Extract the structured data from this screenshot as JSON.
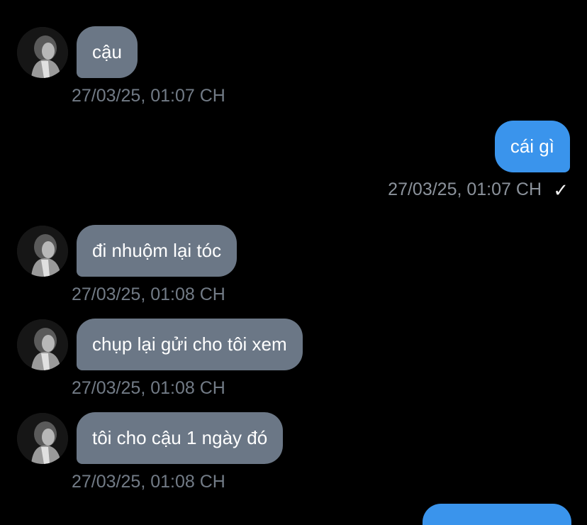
{
  "colors": {
    "background": "#000000",
    "incoming_bubble": "#6b7786",
    "outgoing_bubble": "#3a94ec",
    "timestamp": "#727b86",
    "text": "#ffffff"
  },
  "icons": {
    "avatar": "contact-avatar-photo",
    "read_receipt": "checkmark-icon"
  },
  "messages": [
    {
      "direction": "incoming",
      "text": "cậu",
      "time": "27/03/25, 01:07 CH"
    },
    {
      "direction": "outgoing",
      "text": "cái gì",
      "time": "27/03/25, 01:07 CH",
      "status": "✓"
    },
    {
      "direction": "incoming",
      "text": "đi nhuộm lại tóc",
      "time": "27/03/25, 01:08 CH"
    },
    {
      "direction": "incoming",
      "text": "chụp lại gửi cho tôi xem",
      "time": "27/03/25, 01:08 CH"
    },
    {
      "direction": "incoming",
      "text": "tôi cho cậu 1 ngày đó",
      "time": "27/03/25, 01:08 CH"
    }
  ]
}
